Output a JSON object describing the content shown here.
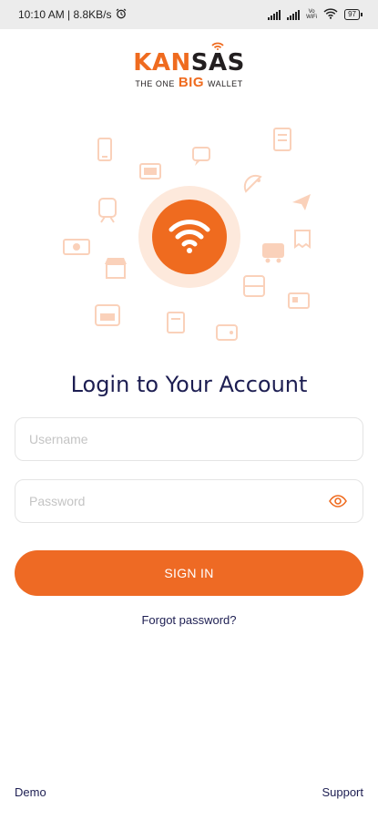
{
  "status_bar": {
    "time_speed": "10:10 AM | 8.8KB/s",
    "alarm_icon": "alarm-clock-icon",
    "volte_line1": "Vo",
    "volte_line2": "WiFi",
    "battery_level": "97"
  },
  "logo": {
    "word_part1": "KAN",
    "word_part2": "SAS",
    "tagline_pre": "THE ONE",
    "tagline_big": "BIG",
    "tagline_post": "WALLET",
    "color_primary": "#ef6b1f",
    "color_dark": "#231f20"
  },
  "hero": {
    "center_icon": "wifi-icon",
    "decorative_icons": [
      "mobile-icon",
      "chat-icon",
      "book-icon",
      "tv-icon",
      "dish-icon",
      "airplane-icon",
      "cash-icon",
      "train-icon",
      "bus-icon",
      "shop-icon",
      "ticket-icon",
      "bed-icon",
      "hotel-icon",
      "satellite-icon",
      "wallet-icon",
      "receipt-icon"
    ]
  },
  "login": {
    "title": "Login to Your Account",
    "username_placeholder": "Username",
    "password_placeholder": "Password",
    "signin_label": "SIGN IN",
    "forgot_label": "Forgot password?"
  },
  "footer": {
    "demo_label": "Demo",
    "support_label": "Support"
  },
  "colors": {
    "accent": "#ee6a24",
    "navy": "#1d1e52"
  }
}
